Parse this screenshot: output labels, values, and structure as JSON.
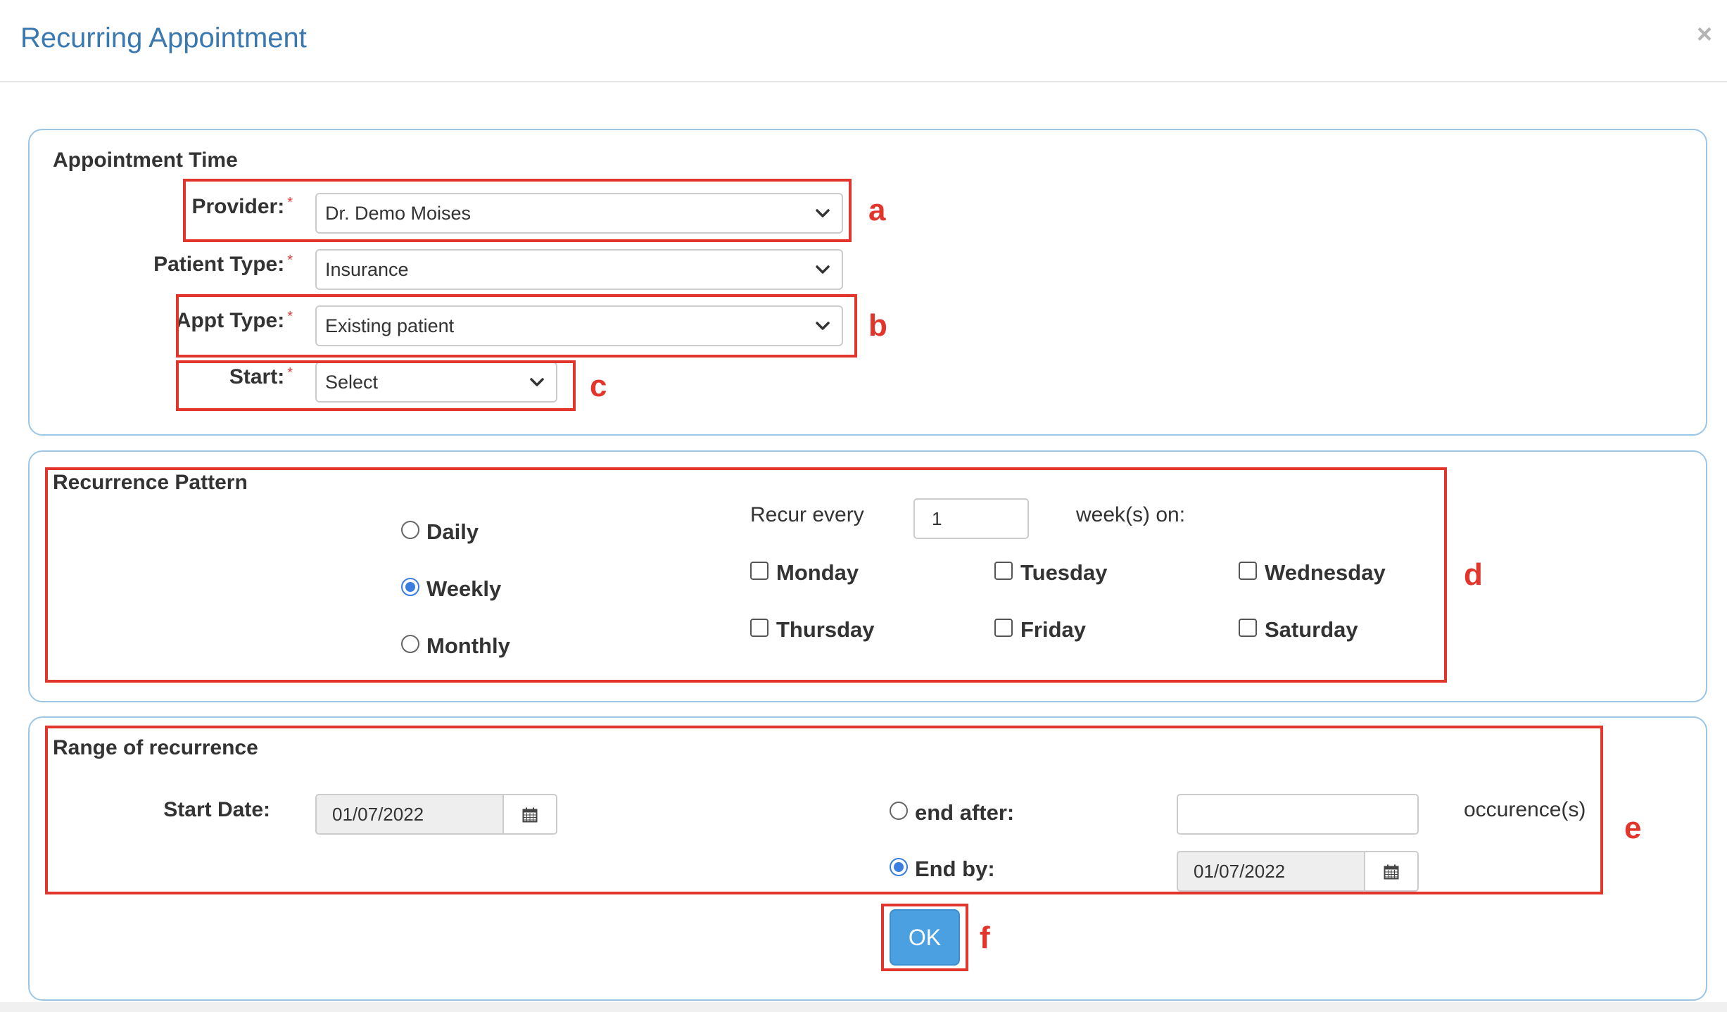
{
  "modal": {
    "title": "Recurring Appointment",
    "close_glyph": "×"
  },
  "appointment_time": {
    "legend": "Appointment Time",
    "provider": {
      "label": "Provider:",
      "value": "Dr. Demo Moises"
    },
    "patient_type": {
      "label": "Patient Type:",
      "value": "Insurance"
    },
    "appt_type": {
      "label": "Appt Type:",
      "value": "Existing patient"
    },
    "start": {
      "label": "Start:",
      "value": "Select"
    },
    "required_marker": "*"
  },
  "recurrence_pattern": {
    "legend": "Recurrence Pattern",
    "options": [
      {
        "label": "Daily",
        "checked": false
      },
      {
        "label": "Weekly",
        "checked": true
      },
      {
        "label": "Monthly",
        "checked": false
      }
    ],
    "recur_every_label": "Recur every",
    "recur_every_value": "1",
    "weeks_on_label": "week(s) on:",
    "days": [
      {
        "label": "Monday",
        "checked": false
      },
      {
        "label": "Tuesday",
        "checked": false
      },
      {
        "label": "Wednesday",
        "checked": false
      },
      {
        "label": "Thursday",
        "checked": false
      },
      {
        "label": "Friday",
        "checked": false
      },
      {
        "label": "Saturday",
        "checked": false
      }
    ]
  },
  "range": {
    "legend": "Range of recurrence",
    "start_date_label": "Start Date:",
    "start_date_value": "01/07/2022",
    "end_after_label": "end after:",
    "end_after_checked": false,
    "end_after_value": "",
    "occurrences_label": "occurence(s)",
    "end_by_label": "End by:",
    "end_by_checked": true,
    "end_by_value": "01/07/2022"
  },
  "ok_label": "OK",
  "annotations": [
    "a",
    "b",
    "c",
    "d",
    "e",
    "f"
  ],
  "colors": {
    "title": "#3a78b0",
    "panel_border": "#9cc6e6",
    "annotation": "#e2362d",
    "ok_button": "#4aa0e0",
    "radio_checked": "#3a7fe0"
  },
  "icons": {
    "close": "close-icon",
    "dropdown": "chevron-down-icon",
    "calendar": "calendar-icon"
  }
}
